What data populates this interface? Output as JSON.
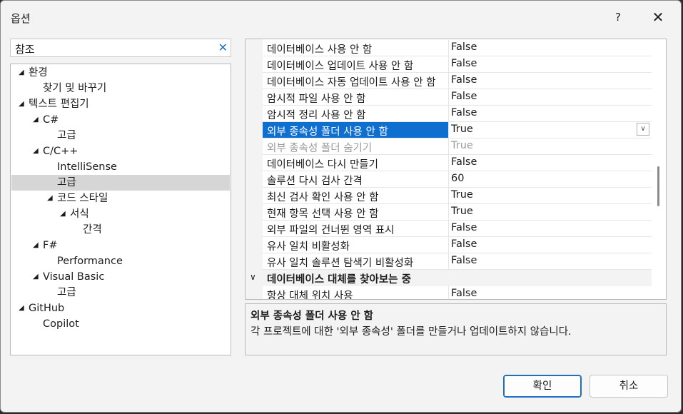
{
  "window": {
    "title": "옵션",
    "help_label": "?",
    "close_label": "✕"
  },
  "search": {
    "value": "참조",
    "clear_label": "✕"
  },
  "tree": [
    {
      "label": "환경",
      "level": 0,
      "expanded": true
    },
    {
      "label": "찾기 및 바꾸기",
      "level": 1
    },
    {
      "label": "텍스트 편집기",
      "level": 0,
      "expanded": true
    },
    {
      "label": "C#",
      "level": 1,
      "expanded": true
    },
    {
      "label": "고급",
      "level": 2
    },
    {
      "label": "C/C++",
      "level": 1,
      "expanded": true
    },
    {
      "label": "IntelliSense",
      "level": 2
    },
    {
      "label": "고급",
      "level": 2,
      "selected": true
    },
    {
      "label": "코드 스타일",
      "level": 2,
      "expanded": true
    },
    {
      "label": "서식",
      "level": 3,
      "expanded": true
    },
    {
      "label": "간격",
      "level": 4
    },
    {
      "label": "F#",
      "level": 1,
      "expanded": true
    },
    {
      "label": "Performance",
      "level": 2
    },
    {
      "label": "Visual Basic",
      "level": 1,
      "expanded": true
    },
    {
      "label": "고급",
      "level": 2
    },
    {
      "label": "GitHub",
      "level": 0,
      "expanded": true
    },
    {
      "label": "Copilot",
      "level": 1
    }
  ],
  "properties": [
    {
      "name": "데이터베이스 사용 안 함",
      "value": "False"
    },
    {
      "name": "데이터베이스 업데이트 사용 안 함",
      "value": "False"
    },
    {
      "name": "데이터베이스 자동 업데이트 사용 안 함",
      "value": "False"
    },
    {
      "name": "암시적 파일 사용 안 함",
      "value": "False"
    },
    {
      "name": "암시적 정리 사용 안 함",
      "value": "False"
    },
    {
      "name": "외부 종속성 폴더 사용 안 함",
      "value": "True",
      "selected": true
    },
    {
      "name": "외부 종속성 폴더 숨기기",
      "value": "True",
      "disabled": true
    },
    {
      "name": "데이터베이스 다시 만들기",
      "value": "False"
    },
    {
      "name": "솔루션 다시 검사 간격",
      "value": "60"
    },
    {
      "name": "최신 검사 확인 사용 안 함",
      "value": "True"
    },
    {
      "name": "현재 항목 선택 사용 안 함",
      "value": "True"
    },
    {
      "name": "외부 파일의 건너뛴 영역 표시",
      "value": "False"
    },
    {
      "name": "유사 일치 비활성화",
      "value": "False"
    },
    {
      "name": "유사 일치 솔루션 탐색기 비활성화",
      "value": "False"
    }
  ],
  "category": {
    "label": "데이터베이스 대체를 찾아보는 중",
    "chevron": "∨"
  },
  "category_rows": [
    {
      "name": "항상 대체 위치 사용",
      "value": "False"
    }
  ],
  "description": {
    "title": "외부 종속성 폴더 사용 안 함",
    "text": "각 프로젝트에 대한 '외부 종속성' 폴더를 만들거나 업데이트하지 않습니다."
  },
  "buttons": {
    "ok": "확인",
    "cancel": "취소"
  },
  "colors": {
    "selection": "#0f6fd1",
    "accent": "#1e6fc1"
  },
  "icons": {
    "expanded": "triangle-down-icon",
    "dropdown": "chevron-down-icon",
    "clear": "close-icon"
  }
}
